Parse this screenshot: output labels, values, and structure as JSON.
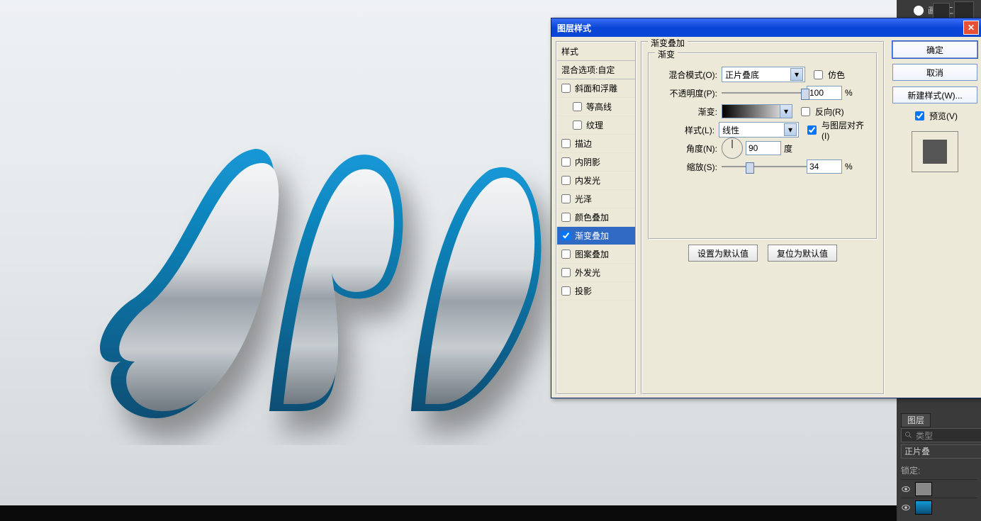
{
  "toolbar": {
    "brush_label": "画笔工具"
  },
  "side": {
    "layers_panel_label": "图层",
    "search_placeholder": "类型",
    "blend_mode_value": "正片叠",
    "lock_label": "锁定:"
  },
  "dialog": {
    "title": "图层样式",
    "styles_header": "样式",
    "blend_options": "混合选项:自定",
    "items": {
      "bevel": "斜面和浮雕",
      "contour": "等高线",
      "texture": "纹理",
      "stroke": "描边",
      "inner_shadow": "内阴影",
      "inner_glow": "内发光",
      "satin": "光泽",
      "color_overlay": "颜色叠加",
      "gradient_overlay": "渐变叠加",
      "pattern_overlay": "图案叠加",
      "outer_glow": "外发光",
      "drop_shadow": "投影"
    },
    "group_title": "渐变叠加",
    "inner_title": "渐变",
    "form": {
      "blend_mode_label": "混合模式(O):",
      "blend_mode_value": "正片叠底",
      "dither_label": "仿色",
      "opacity_label": "不透明度(P):",
      "opacity_value": "100",
      "opacity_pct": "%",
      "gradient_label": "渐变:",
      "reverse_label": "反向(R)",
      "style_label": "样式(L):",
      "style_value": "线性",
      "align_label": "与图层对齐(I)",
      "angle_label": "角度(N):",
      "angle_value": "90",
      "angle_unit": "度",
      "scale_label": "缩放(S):",
      "scale_value": "34",
      "scale_pct": "%"
    },
    "buttons": {
      "make_default": "设置为默认值",
      "reset_default": "复位为默认值"
    },
    "right": {
      "ok": "确定",
      "cancel": "取消",
      "new_style": "新建样式(W)...",
      "preview": "预览(V)"
    }
  }
}
